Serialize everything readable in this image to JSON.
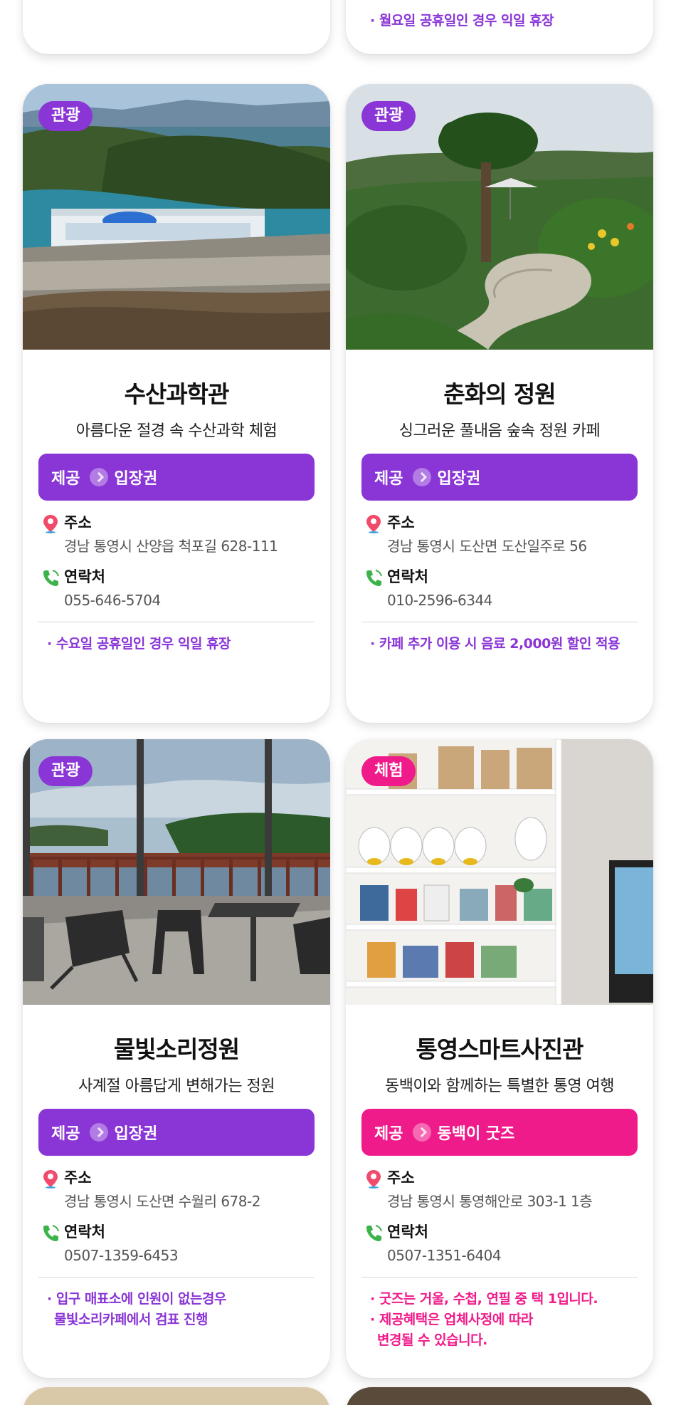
{
  "top_cards": [
    {
      "notes": []
    },
    {
      "notes": [
        "· 월요일 공휴일인 경우 익일 휴장"
      ]
    }
  ],
  "labels": {
    "provide": "제공",
    "address": "주소",
    "contact": "연락처"
  },
  "cards": [
    {
      "category": "관광",
      "title": "수산과학관",
      "subtitle": "아름다운 절경 속 수산과학 체험",
      "benefit": "입장권",
      "address": "경남 통영시 산양읍 척포길 628-111",
      "phone": "055-646-5704",
      "notes": [
        "· 수요일 공휴일인 경우 익일 휴장"
      ],
      "theme": "purple"
    },
    {
      "category": "관광",
      "title": "춘화의 정원",
      "subtitle": "싱그러운 풀내음 숲속 정원 카페",
      "benefit": "입장권",
      "address": "경남 통영시 도산면 도산일주로 56",
      "phone": "010-2596-6344",
      "notes": [
        "· 카페 추가 이용 시 음료 2,000원 할인 적용"
      ],
      "theme": "purple"
    },
    {
      "category": "관광",
      "title": "물빛소리정원",
      "subtitle": "사계절 아름답게 변해가는 정원",
      "benefit": "입장권",
      "address": "경남 통영시 도산면 수월리 678-2",
      "phone": "0507-1359-6453",
      "notes": [
        "· 입구 매표소에 인원이 없는경우",
        "물빛소리카페에서 검표 진행"
      ],
      "theme": "purple"
    },
    {
      "category": "체험",
      "title": "통영스마트사진관",
      "subtitle": "동백이와 함께하는 특별한 통영 여행",
      "benefit": "동백이 굿즈",
      "address": "경남 통영시 통영해안로 303-1 1층",
      "phone": "0507-1351-6404",
      "notes": [
        "· 굿즈는 거울, 수첩, 연필 중 택 1입니다.",
        "· 제공혜택은 업체사정에 따라",
        "변경될 수 있습니다."
      ],
      "theme": "pink"
    }
  ],
  "colors": {
    "purple": "#8a35d6",
    "pink": "#f01b8a"
  }
}
